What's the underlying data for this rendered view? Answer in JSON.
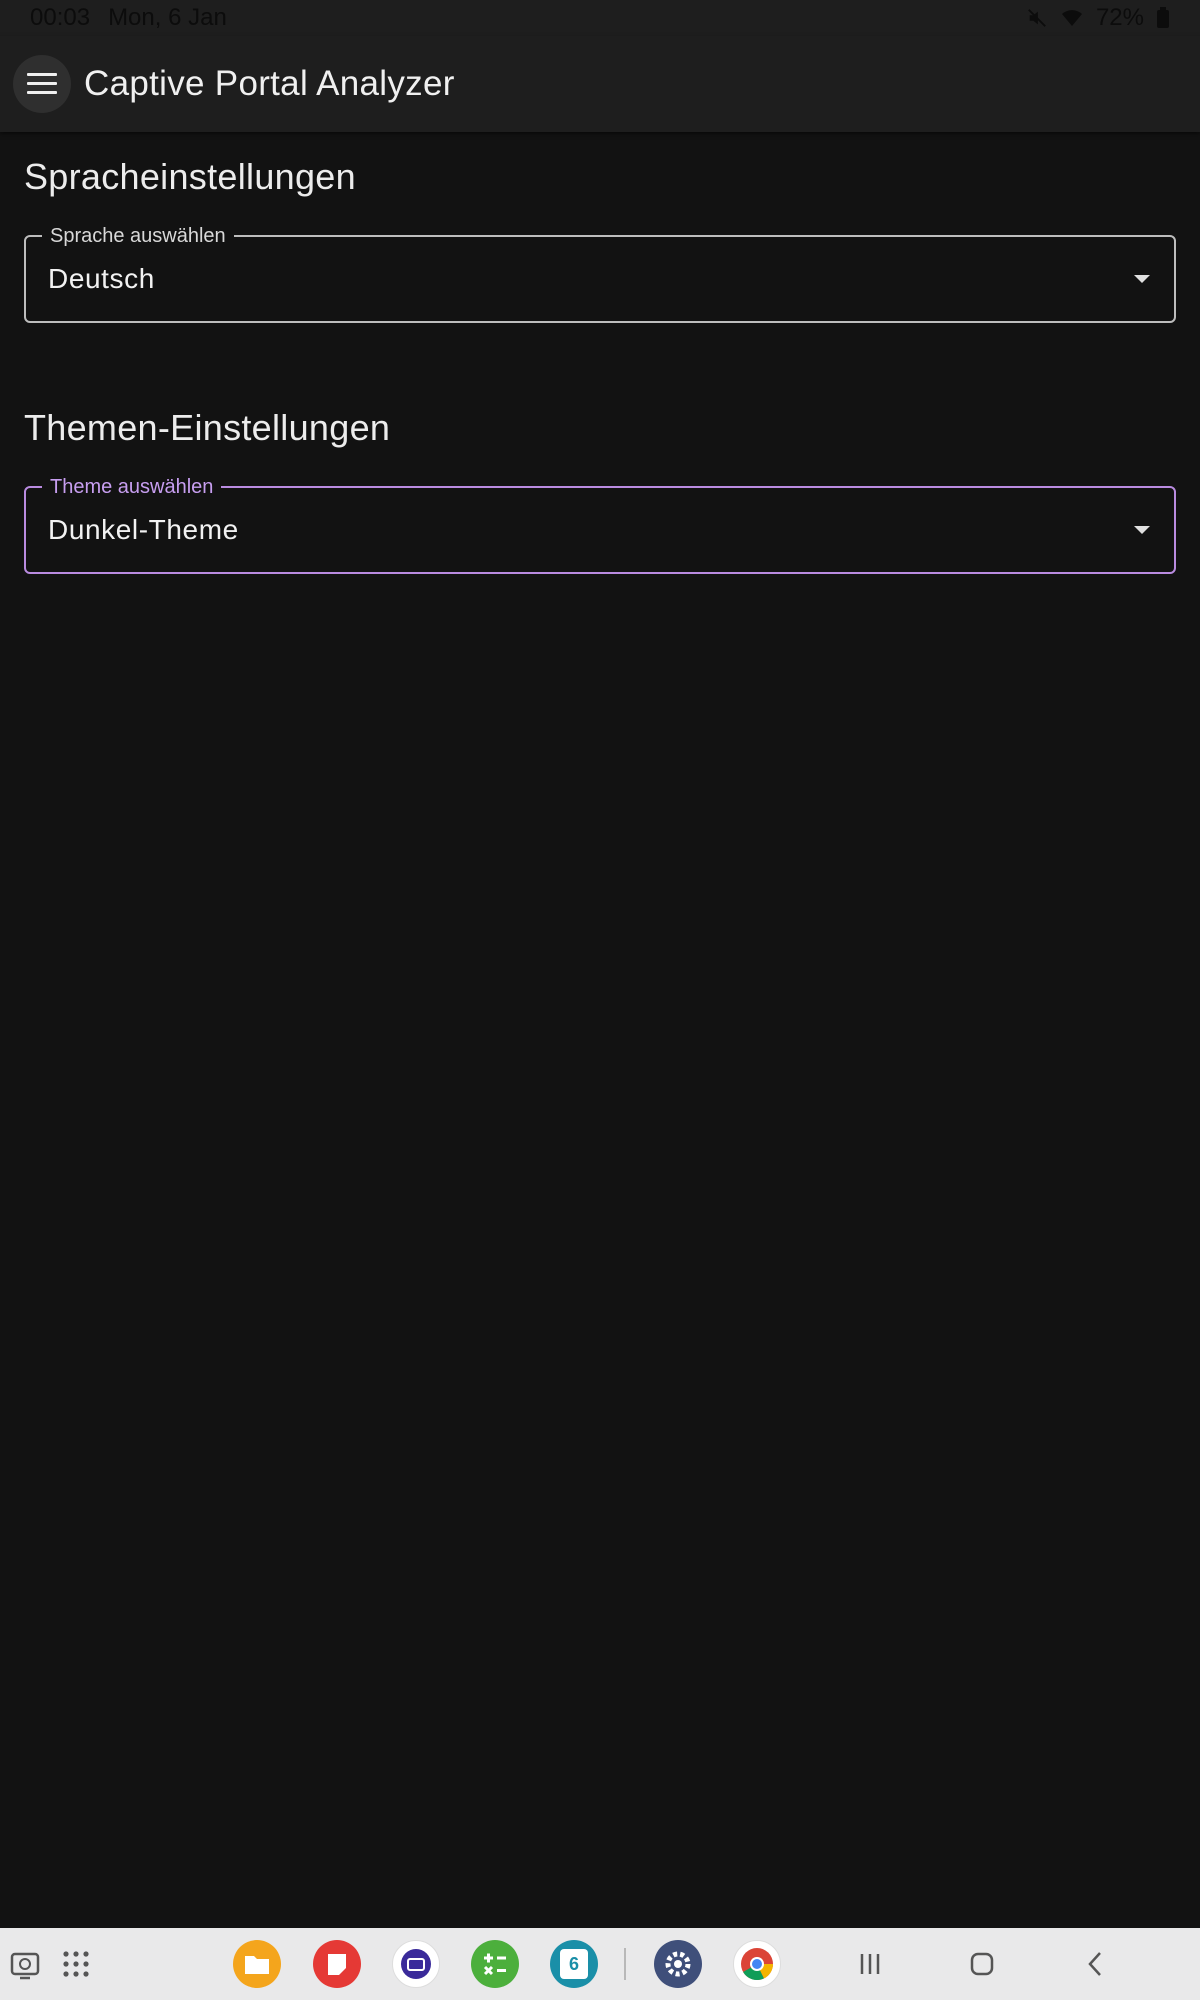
{
  "status_bar": {
    "time": "00:03",
    "date": "Mon, 6 Jan",
    "battery": "72%"
  },
  "app_bar": {
    "title": "Captive Portal Analyzer",
    "menu_icon": "menu-icon"
  },
  "language_section": {
    "title": "Spracheinstellungen",
    "field_label": "Sprache auswählen",
    "selected_value": "Deutsch"
  },
  "theme_section": {
    "title": "Themen-Einstellungen",
    "field_label": "Theme auswählen",
    "selected_value": "Dunkel-Theme"
  },
  "taskbar": {
    "apps": [
      {
        "name": "my-files",
        "icon": "folder-icon",
        "color": "#f4a51c"
      },
      {
        "name": "notes",
        "icon": "note-icon",
        "color": "#e53935"
      },
      {
        "name": "iptv",
        "icon": "tv-icon",
        "color": "#ffffff"
      },
      {
        "name": "calculator",
        "icon": "calculator-icon",
        "color": "#4caf3c"
      },
      {
        "name": "calendar",
        "icon": "calendar-icon",
        "color": "#1a8fa8",
        "text": "6"
      },
      {
        "name": "settings",
        "icon": "gear-icon",
        "color": "#3f4f7a"
      },
      {
        "name": "chrome",
        "icon": "chrome-icon",
        "color": "#ffffff"
      }
    ]
  },
  "colors": {
    "background": "#121212",
    "app_bar": "#1e1e1e",
    "accent": "#b98be0"
  }
}
